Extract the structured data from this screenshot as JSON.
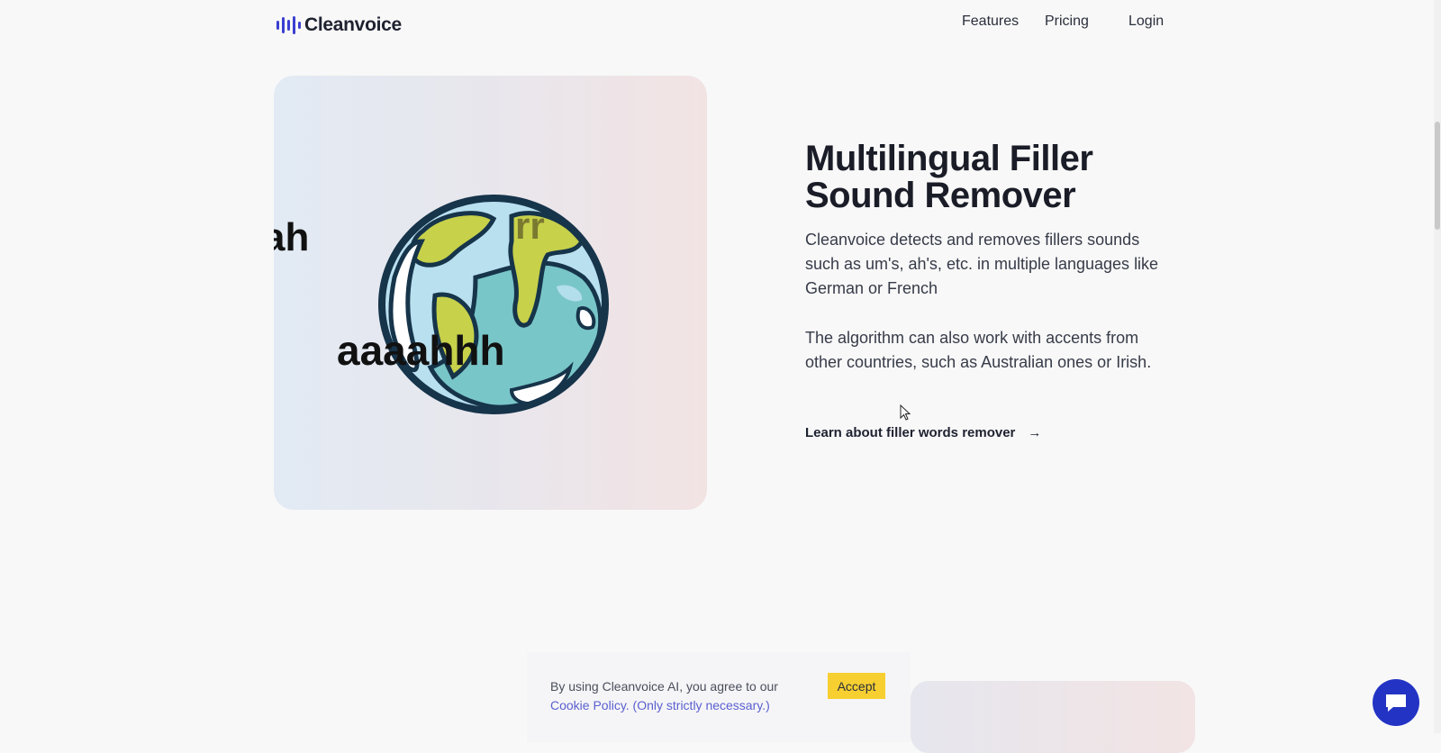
{
  "header": {
    "logo_text": "Cleanvoice",
    "nav": {
      "features": "Features",
      "pricing": "Pricing",
      "login": "Login"
    }
  },
  "hero": {
    "fillers": {
      "a": "ah",
      "b": "rr",
      "c": "aaaahhh"
    },
    "colors": {
      "ocean_light": "#b9e0ef",
      "ocean_teal": "#79c6c8",
      "land": "#c7d14a",
      "outline": "#16344a"
    }
  },
  "section": {
    "headline": "Multilingual Filler Sound Remover",
    "paragraph1": "Cleanvoice detects and removes fillers sounds such as um's, ah's, etc. in multiple languages like German or French",
    "paragraph2": "The algorithm can also work with accents from other countries, such as Australian ones or Irish.",
    "learn_link": "Learn about filler words remover",
    "arrow": "→"
  },
  "cookie": {
    "text": "By using Cleanvoice AI, you agree to our ",
    "link": "Cookie Policy. (Only strictly necessary.)",
    "accept": "Accept",
    "accept_color": "#f7cf30"
  },
  "chat": {
    "icon": "chat-bubble-icon",
    "color": "#2334c4"
  }
}
